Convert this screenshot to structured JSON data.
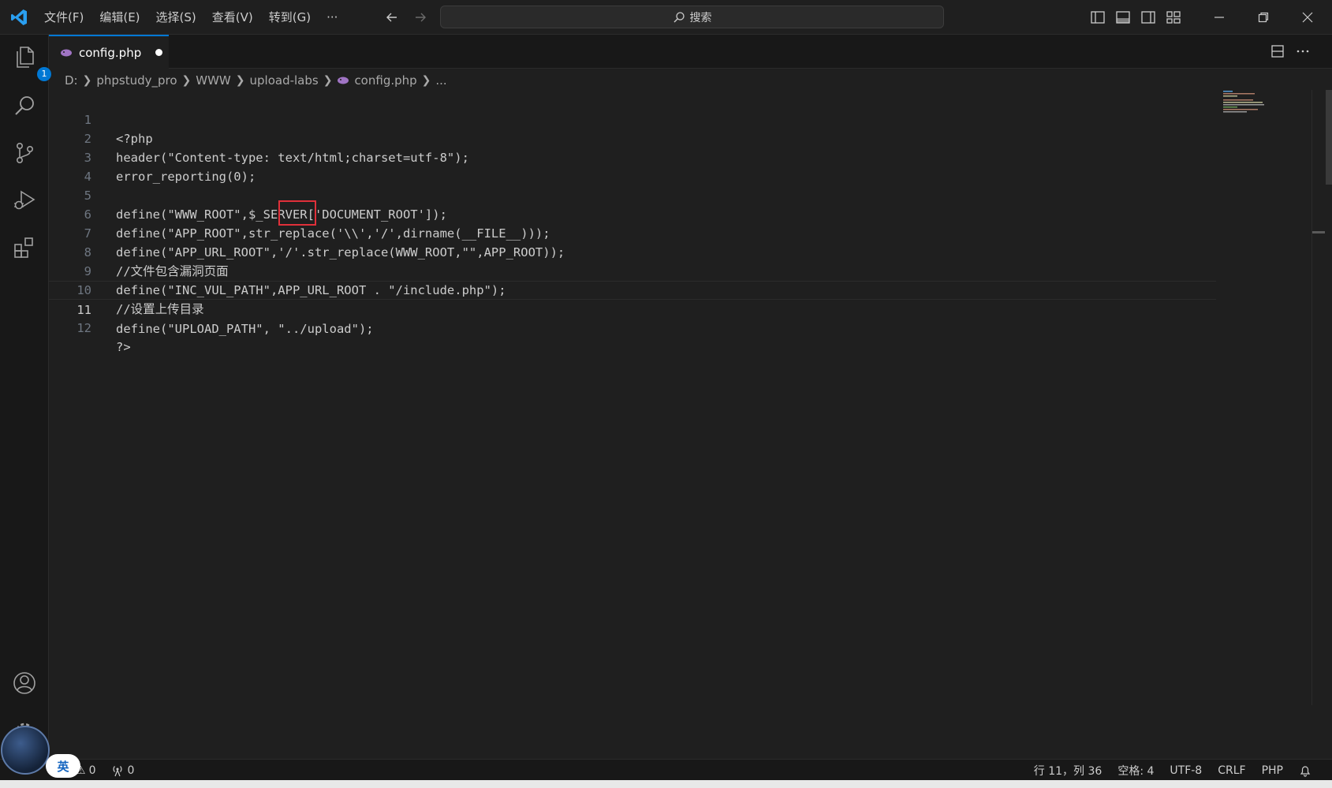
{
  "menu": [
    "文件(F)",
    "编辑(E)",
    "选择(S)",
    "查看(V)",
    "转到(G)",
    "···"
  ],
  "search": {
    "placeholder": "搜索"
  },
  "explorer_badge": "1",
  "tab": {
    "label": "config.php",
    "modified": true
  },
  "breadcrumb": [
    "D:",
    "phpstudy_pro",
    "WWW",
    "upload-labs",
    "config.php",
    "..."
  ],
  "code_lines": [
    "<?php",
    "header(\"Content-type: text/html;charset=utf-8\");",
    "error_reporting(0);",
    "",
    "define(\"WWW_ROOT\",$_SERVER['DOCUMENT_ROOT']);",
    "define(\"APP_ROOT\",str_replace('\\\\','/',dirname(__FILE__)));",
    "define(\"APP_URL_ROOT\",'/'.str_replace(WWW_ROOT,\"\",APP_ROOT));",
    "//文件包含漏洞页面",
    "define(\"INC_VUL_PATH\",APP_URL_ROOT . \"/include.php\");",
    "//设置上传目录",
    "define(\"UPLOAD_PATH\", \"../upload\");",
    "?>"
  ],
  "current_line": 11,
  "statusbar": {
    "errors": "0",
    "warnings": "0",
    "ports": "0",
    "position": "行 11，列 36",
    "indent": "空格: 4",
    "encoding": "UTF-8",
    "eol": "CRLF",
    "language": "PHP"
  },
  "ime_label": "英",
  "colors": {
    "accent": "#0078d4",
    "highlight_box": "#e0303a",
    "background": "#1f1f1f"
  }
}
